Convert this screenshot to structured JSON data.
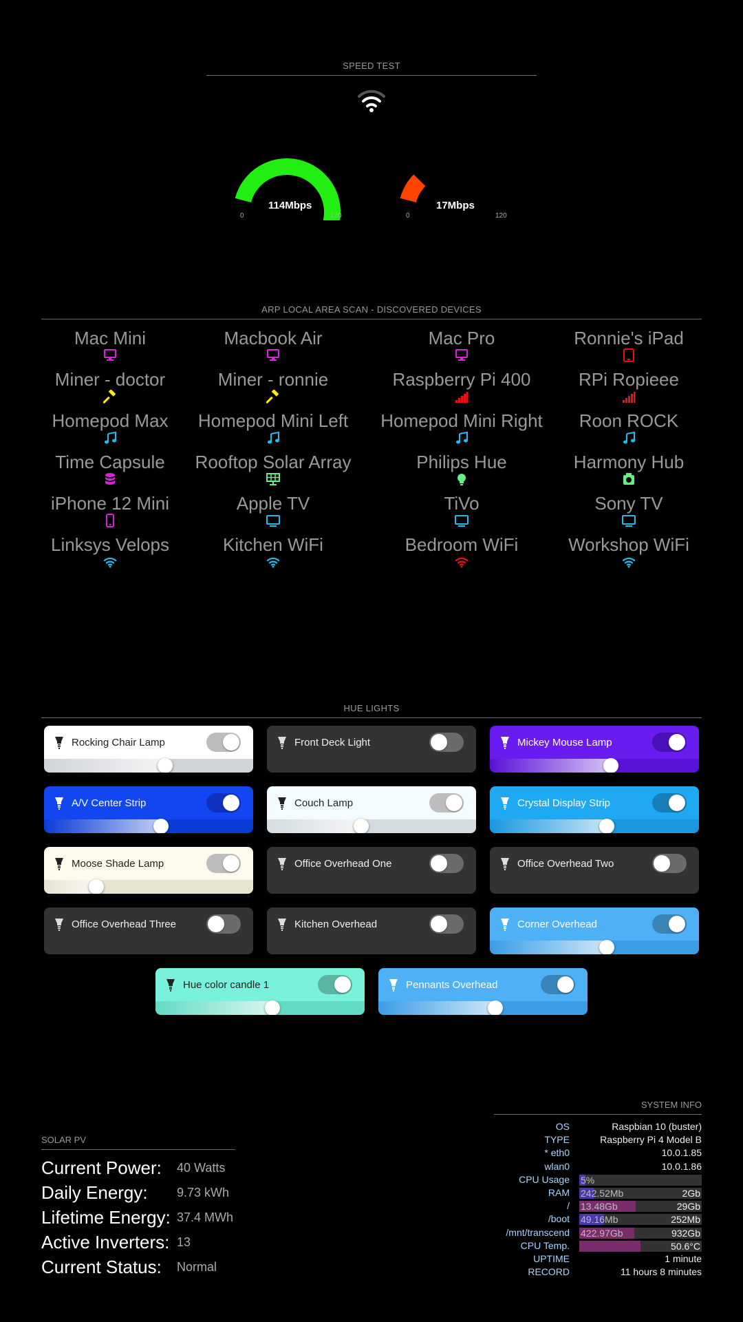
{
  "speedtest": {
    "header": "SPEED TEST",
    "download": {
      "value": "114Mbps",
      "min": "0",
      "max": "120",
      "fraction": 0.95,
      "color": "#22ee11"
    },
    "upload": {
      "value": "17Mbps",
      "min": "0",
      "max": "120",
      "fraction": 0.14,
      "color": "#ff4400"
    }
  },
  "arp": {
    "header": "ARP LOCAL AREA SCAN - DISCOVERED DEVICES",
    "devices": [
      {
        "name": "Mac Mini",
        "icon": "desktop-icon",
        "color": "#dd22dd"
      },
      {
        "name": "Macbook Air",
        "icon": "desktop-icon",
        "color": "#dd22dd"
      },
      {
        "name": "Mac Pro",
        "icon": "desktop-icon",
        "color": "#dd22dd"
      },
      {
        "name": "Ronnie's iPad",
        "icon": "tablet-icon",
        "color": "#ee1111"
      },
      {
        "name": "Miner - doctor",
        "icon": "hammer-icon",
        "color": "#ffee00"
      },
      {
        "name": "Miner - ronnie",
        "icon": "hammer-icon",
        "color": "#ffee00"
      },
      {
        "name": "Raspberry Pi 400",
        "icon": "signal-icon",
        "color": "#ee1111"
      },
      {
        "name": "RPi Ropieee",
        "icon": "signal-icon",
        "color": "#ee1111"
      },
      {
        "name": "Homepod Max",
        "icon": "music-icon",
        "color": "#22bbee"
      },
      {
        "name": "Homepod Mini Left",
        "icon": "music-icon",
        "color": "#22bbee"
      },
      {
        "name": "Homepod Mini Right",
        "icon": "music-icon",
        "color": "#22bbee"
      },
      {
        "name": "Roon ROCK",
        "icon": "music-icon",
        "color": "#22bbee"
      },
      {
        "name": "Time Capsule",
        "icon": "database-icon",
        "color": "#dd22dd"
      },
      {
        "name": "Rooftop Solar Array",
        "icon": "solar-panel-icon",
        "color": "#66ee88"
      },
      {
        "name": "Philips Hue",
        "icon": "lightbulb-icon",
        "color": "#66ee88"
      },
      {
        "name": "Harmony Hub",
        "icon": "hub-icon",
        "color": "#66ee88"
      },
      {
        "name": "iPhone 12 Mini",
        "icon": "phone-icon",
        "color": "#dd22dd"
      },
      {
        "name": "Apple TV",
        "icon": "tv-icon",
        "color": "#22bbee"
      },
      {
        "name": "TiVo",
        "icon": "tv-icon",
        "color": "#22bbee"
      },
      {
        "name": "Sony TV",
        "icon": "tv-icon",
        "color": "#22bbee"
      },
      {
        "name": "Linksys Velops",
        "icon": "wifi-icon",
        "color": "#22bbee"
      },
      {
        "name": "Kitchen WiFi",
        "icon": "wifi-icon",
        "color": "#22bbee"
      },
      {
        "name": "Bedroom WiFi",
        "icon": "wifi-icon",
        "color": "#ee1111"
      },
      {
        "name": "Workshop WiFi",
        "icon": "wifi-icon",
        "color": "#22bbee"
      }
    ]
  },
  "hue": {
    "header": "HUE LIGHTS",
    "lights": [
      {
        "name": "Rocking Chair Lamp",
        "on": false,
        "brightness": 0.58,
        "bg": "#ffffff",
        "track": "#d0d4d8",
        "text": "#222222",
        "icon": "#222222",
        "tint": "#ffffff"
      },
      {
        "name": "Front Deck Light",
        "on": false,
        "brightness": null,
        "bg": "#333333",
        "text": "#eeeeee",
        "icon": "#dddddd"
      },
      {
        "name": "Mickey Mouse Lamp",
        "on": true,
        "brightness": 0.58,
        "bg": "#6a1cf0",
        "track": "#5a12d8",
        "text": "#ffffff",
        "icon": "#ffffff",
        "tint": "#ffffff"
      },
      {
        "name": "A/V Center Strip",
        "on": true,
        "brightness": 0.56,
        "bg": "#1146f0",
        "track": "#0b3bd6",
        "text": "#ffffff",
        "icon": "#ffffff",
        "tint": "#ffffff"
      },
      {
        "name": "Couch Lamp",
        "on": false,
        "brightness": 0.45,
        "bg": "#f4fbff",
        "track": "#d5dbdf",
        "text": "#222222",
        "icon": "#222222",
        "tint": "#ffffff"
      },
      {
        "name": "Crystal Display Strip",
        "on": true,
        "brightness": 0.56,
        "bg": "#20a9f3",
        "track": "#1a97de",
        "text": "#ffffff",
        "icon": "#ffffff",
        "tint": "#ffffff"
      },
      {
        "name": "Moose Shade Lamp",
        "on": false,
        "brightness": 0.25,
        "bg": "#fcfaea",
        "track": "#e8e4d2",
        "text": "#222222",
        "icon": "#222222",
        "tint": "#ffffff"
      },
      {
        "name": "Office Overhead One",
        "on": false,
        "brightness": null,
        "bg": "#333333",
        "text": "#eeeeee",
        "icon": "#dddddd"
      },
      {
        "name": "Office Overhead Two",
        "on": false,
        "brightness": null,
        "bg": "#333333",
        "text": "#eeeeee",
        "icon": "#dddddd"
      },
      {
        "name": "Office Overhead Three",
        "on": false,
        "brightness": null,
        "bg": "#333333",
        "text": "#eeeeee",
        "icon": "#dddddd"
      },
      {
        "name": "Kitchen Overhead",
        "on": false,
        "brightness": null,
        "bg": "#333333",
        "text": "#eeeeee",
        "icon": "#dddddd"
      },
      {
        "name": "Corner Overhead",
        "on": true,
        "brightness": 0.56,
        "bg": "#4eb0f5",
        "track": "#3a9de6",
        "text": "#ffffff",
        "icon": "#ffffff",
        "tint": "#ffffff"
      },
      {
        "name": "Hue color candle 1",
        "on": true,
        "brightness": 0.56,
        "bg": "#79f2dc",
        "track": "#62dbc4",
        "text": "#222222",
        "icon": "#222222",
        "tint": "#ffffff"
      },
      {
        "name": "Pennants Overhead",
        "on": true,
        "brightness": 0.56,
        "bg": "#4eb0f5",
        "track": "#3a9de6",
        "text": "#ffffff",
        "icon": "#ffffff",
        "tint": "#ffffff"
      }
    ]
  },
  "solar": {
    "header": "SOLAR PV",
    "rows": [
      {
        "label": "Current Power:",
        "value": "40 Watts"
      },
      {
        "label": "Daily Energy:",
        "value": "9.73 kWh"
      },
      {
        "label": "Lifetime Energy:",
        "value": "37.4 MWh"
      },
      {
        "label": "Active Inverters:",
        "value": "13"
      },
      {
        "label": "Current Status:",
        "value": "Normal"
      }
    ]
  },
  "sysinfo": {
    "header": "SYSTEM INFO",
    "os": {
      "label": "OS",
      "value": "Raspbian 10 (buster)"
    },
    "type": {
      "label": "TYPE",
      "value": "Raspberry Pi 4 Model B"
    },
    "eth0": {
      "label": "* eth0",
      "value": "10.0.1.85"
    },
    "wlan0": {
      "label": "wlan0",
      "value": "10.0.1.86"
    },
    "cpu": {
      "label": "CPU Usage",
      "used": "5%",
      "total": "",
      "fraction": 0.05,
      "color": "#4a3aa8"
    },
    "ram": {
      "label": "RAM",
      "used": "242.52Mb",
      "total": "2Gb",
      "fraction": 0.12,
      "color": "#4a3aa8"
    },
    "root": {
      "label": "/",
      "used": "13.48Gb",
      "total": "29Gb",
      "fraction": 0.46,
      "color": "#7a2d6a"
    },
    "boot": {
      "label": "/boot",
      "used": "49.16Mb",
      "total": "252Mb",
      "fraction": 0.2,
      "color": "#4a3aa8"
    },
    "transcend": {
      "label": "/mnt/transcend",
      "used": "422.97Gb",
      "total": "932Gb",
      "fraction": 0.45,
      "color": "#7a2d6a"
    },
    "temp": {
      "label": "CPU Temp.",
      "used": "",
      "total": "50.6°C",
      "fraction": 0.5,
      "color": "#7a2d6a"
    },
    "uptime": {
      "label": "UPTIME",
      "value": "1 minute"
    },
    "record": {
      "label": "RECORD",
      "value": "11 hours 8 minutes"
    }
  }
}
